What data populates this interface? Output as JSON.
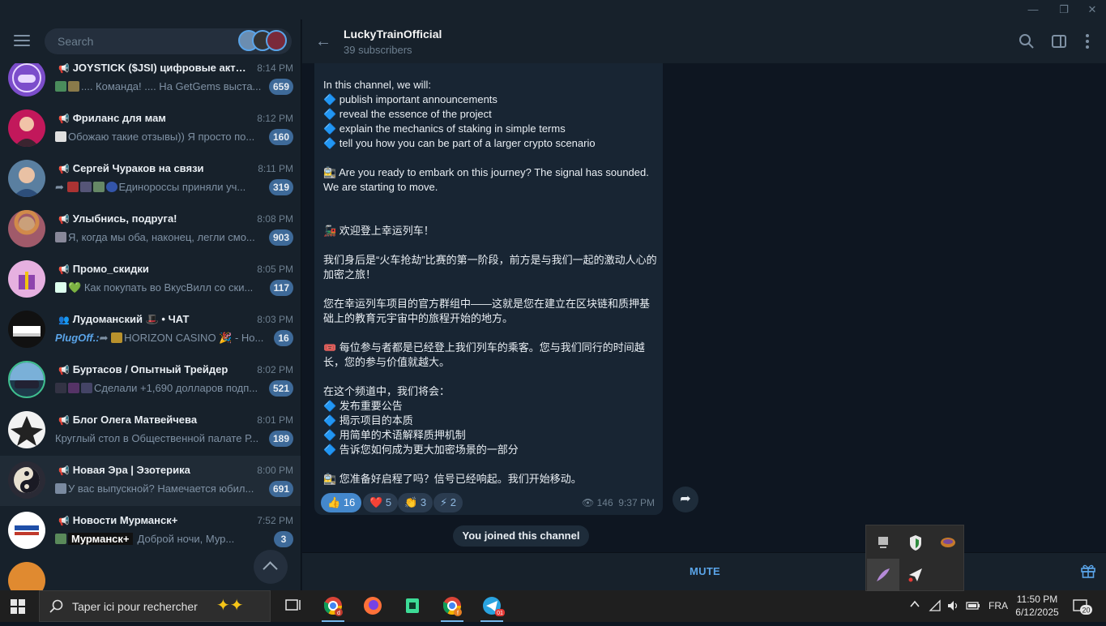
{
  "window": {
    "minimize": "—",
    "restore": "❐",
    "close": "✕"
  },
  "sidebar": {
    "search_placeholder": "Search",
    "chats": [
      {
        "name": "JOYSTICK ($JSI) цифровые актив...",
        "time": "8:14 PM",
        "preview": ".... Команда!  .... На GetGems выста...",
        "badge": "659",
        "type": "channel"
      },
      {
        "name": "Фриланс для мам",
        "time": "8:12 PM",
        "preview": "Обожаю такие отзывы)) Я просто по...",
        "badge": "160",
        "type": "channel"
      },
      {
        "name": "Сергей Чураков на связи",
        "time": "8:11 PM",
        "preview": "Единороссы приняли уч...",
        "badge": "319",
        "type": "channel"
      },
      {
        "name": "Улыбнись, подруга!",
        "time": "8:08 PM",
        "preview": "Я, когда мы оба, наконец, легли смо...",
        "badge": "903",
        "type": "channel"
      },
      {
        "name": "Промо_скидки",
        "time": "8:05 PM",
        "preview": "Как покупать во ВкусВилл со ски...",
        "badge": "117",
        "type": "channel"
      },
      {
        "name": "Лудоманский 🎩 • ЧАТ",
        "time": "8:03 PM",
        "sender": "PlugOff.:",
        "preview": "HORIZON CASINO 🎉 - Ho...",
        "badge": "16",
        "type": "group"
      },
      {
        "name": "Буртасов / Опытный Трейдер",
        "time": "8:02 PM",
        "preview": "Сделали +1,690 долларов подп...",
        "badge": "521",
        "type": "channel"
      },
      {
        "name": "Блог Олега Матвейчева",
        "time": "8:01 PM",
        "preview": "Круглый стол в Общественной палате Р...",
        "badge": "189",
        "type": "channel"
      },
      {
        "name": "Новая Эра | Эзотерика",
        "time": "8:00 PM",
        "preview": "У вас выпускной? Намечается юбил...",
        "badge": "691",
        "type": "channel"
      },
      {
        "name": "Новости Мурманск+",
        "time": "7:52 PM",
        "preview": "Доброй ночи, Мур...",
        "badge": "3",
        "type": "channel",
        "tag": "Мурманск+"
      }
    ]
  },
  "chat": {
    "title": "LuckyTrainOfficial",
    "subtitle": "39 subscribers",
    "message_text": "In this channel, we will:\n🔷 publish important announcements\n🔷 reveal the essence of the project\n🔷 explain the mechanics of staking in simple terms\n🔷 tell you how you can be part of a larger crypto scenario\n\n🚉 Are you ready to embark on this journey? The signal has sounded. We are starting to move.\n\n\n🚂 欢迎登上幸运列车！\n\n我们身后是“火车抢劫”比赛的第一阶段，前方是与我们一起的激动人心的加密之旅！\n\n您在幸运列车项目的官方群组中——这就是您在建立在区块链和质押基础上的教育元宇宙中的旅程开始的地方。\n\n🎟️ 每位参与者都是已经登上我们列车的乘客。您与我们同行的时间越长，您的参与价值就越大。\n\n在这个频道中，我们将会：\n🔷 发布重要公告\n🔷 揭示项目的本质\n🔷 用简单的术语解释质押机制\n🔷 告诉您如何成为更大加密场景的一部分\n\n🚉 您准备好启程了吗？信号已经响起。我们开始移动。",
    "reactions": [
      {
        "emoji": "👍",
        "count": "16",
        "mine": true
      },
      {
        "emoji": "❤️",
        "count": "5",
        "mine": false
      },
      {
        "emoji": "👏",
        "count": "3",
        "mine": false
      },
      {
        "emoji": "⚡",
        "count": "2",
        "mine": false
      }
    ],
    "views": "146",
    "time": "9:37 PM",
    "service_message": "You joined this channel",
    "mute_label": "MUTE"
  },
  "taskbar": {
    "search_text": "Taper ici pour rechercher",
    "language": "FRA",
    "time": "11:50 PM",
    "date": "6/12/2025",
    "notifications": "20",
    "chrome_badge_1": "d",
    "chrome_badge_2": "f",
    "telegram_badge": "01"
  },
  "colors": {
    "accent": "#5aa4e8",
    "bubble": "#182533",
    "sidebar": "#17212b",
    "background": "#0e1621"
  }
}
